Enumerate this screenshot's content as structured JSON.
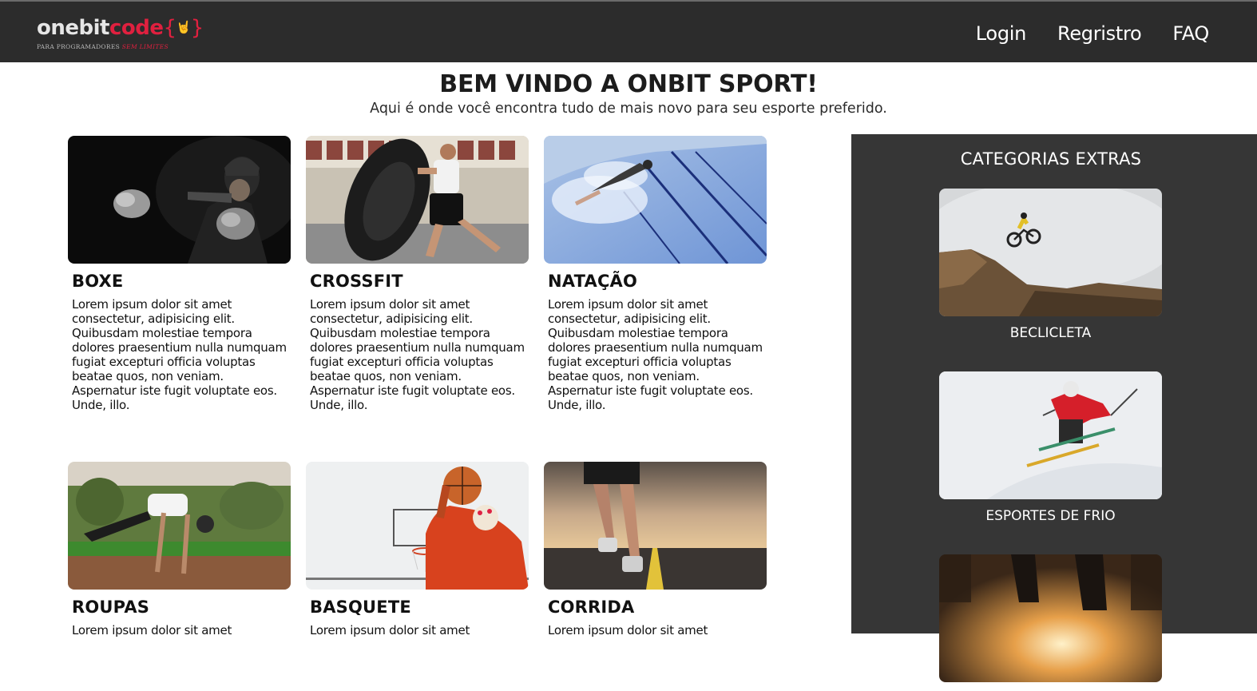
{
  "brand": {
    "logo_primary": "onebit",
    "logo_accent": "code",
    "logo_braces_open": "{",
    "logo_braces_close": "}",
    "logo_tag_plain": "PARA PROGRAMADORES",
    "logo_tag_accent": "SEM LIMITES",
    "accent_color": "#e0203f"
  },
  "nav": {
    "items": [
      {
        "label": "Login"
      },
      {
        "label": "Regristro"
      },
      {
        "label": "FAQ"
      }
    ]
  },
  "hero": {
    "title": "BEM VINDO A ONBIT SPORT!",
    "subtitle": "Aqui é onde você encontra tudo de mais novo para seu esporte preferido."
  },
  "cards": [
    {
      "title": "BOXE",
      "text": "Lorem ipsum dolor sit amet consectetur, adipisicing elit. Quibusdam molestiae tempora dolores praesentium nulla numquam fugiat excepturi officia voluptas beatae quos, non veniam. Aspernatur iste fugit voluptate eos. Unde, illo."
    },
    {
      "title": "CROSSFIT",
      "text": "Lorem ipsum dolor sit amet consectetur, adipisicing elit. Quibusdam molestiae tempora dolores praesentium nulla numquam fugiat excepturi officia voluptas beatae quos, non veniam. Aspernatur iste fugit voluptate eos. Unde, illo."
    },
    {
      "title": "NATAÇÃO",
      "text": "Lorem ipsum dolor sit amet consectetur, adipisicing elit. Quibusdam molestiae tempora dolores praesentium nulla numquam fugiat excepturi officia voluptas beatae quos, non veniam. Aspernatur iste fugit voluptate eos. Unde, illo."
    },
    {
      "title": "ROUPAS",
      "text": "Lorem ipsum dolor sit amet"
    },
    {
      "title": "BASQUETE",
      "text": "Lorem ipsum dolor sit amet"
    },
    {
      "title": "CORRIDA",
      "text": "Lorem ipsum dolor sit amet"
    }
  ],
  "sidebar": {
    "title": "CATEGORIAS EXTRAS",
    "items": [
      {
        "label": "BECLICLETA"
      },
      {
        "label": "ESPORTES DE FRIO"
      },
      {
        "label": ""
      }
    ]
  },
  "colors": {
    "navbar_bg": "#2c2c2c",
    "sidebar_bg": "#363636"
  }
}
